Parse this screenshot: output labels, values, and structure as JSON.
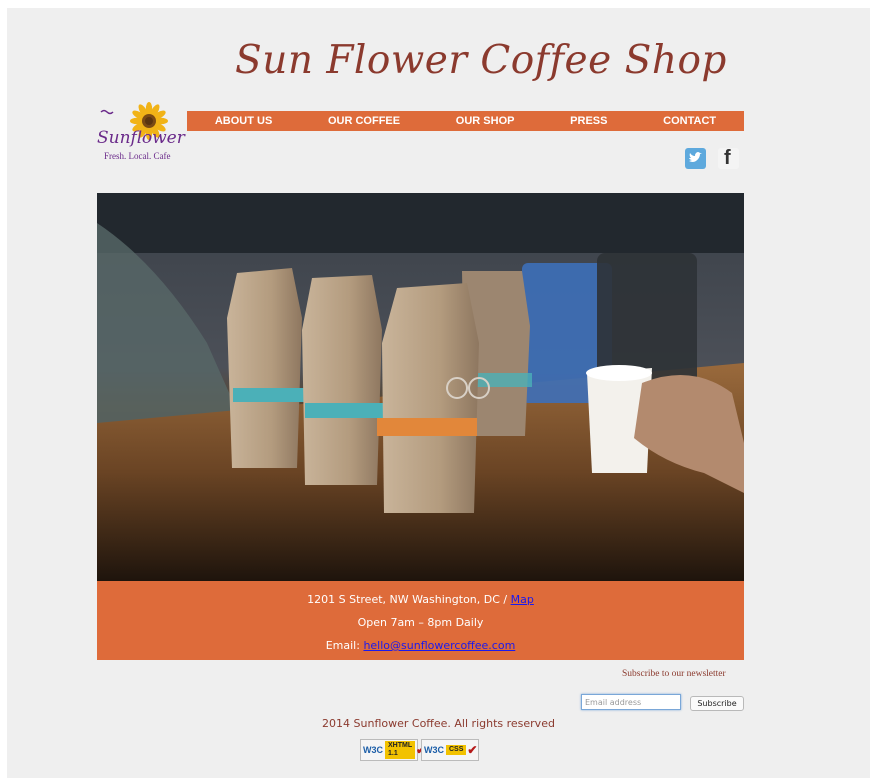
{
  "site": {
    "title": "Sun Flower Coffee Shop",
    "logo_word": "Sunflower",
    "logo_tagline": "Fresh. Local. Cafe"
  },
  "nav": {
    "items": [
      {
        "label": "ABOUT US"
      },
      {
        "label": "OUR COFFEE"
      },
      {
        "label": "OUR SHOP"
      },
      {
        "label": "PRESS"
      },
      {
        "label": "CONTACT"
      }
    ]
  },
  "social": {
    "twitter": {
      "icon": "twitter-icon"
    },
    "facebook": {
      "icon": "facebook-icon",
      "glyph": "f"
    }
  },
  "info": {
    "address": "1201 S Street, NW Washington, DC / ",
    "map_link": "Map",
    "hours": "Open 7am – 8pm Daily",
    "email_label": "Email: ",
    "email": "hello@sunflowercoffee.com"
  },
  "newsletter": {
    "label": "Subscribe to our newsletter",
    "placeholder": "Email address",
    "value": "",
    "button": "Subscribe"
  },
  "footer": {
    "copyright": "2014 Sunflower Coffee. All rights reserved",
    "badges": [
      {
        "org": "W3C",
        "kind": "XHTML 1.1"
      },
      {
        "org": "W3C",
        "kind": "CSS"
      }
    ]
  },
  "colors": {
    "accent": "#de6b3a",
    "title": "#8b3a2e",
    "logo": "#6a2a8a",
    "link": "#1a1aee",
    "background": "#efefef"
  }
}
